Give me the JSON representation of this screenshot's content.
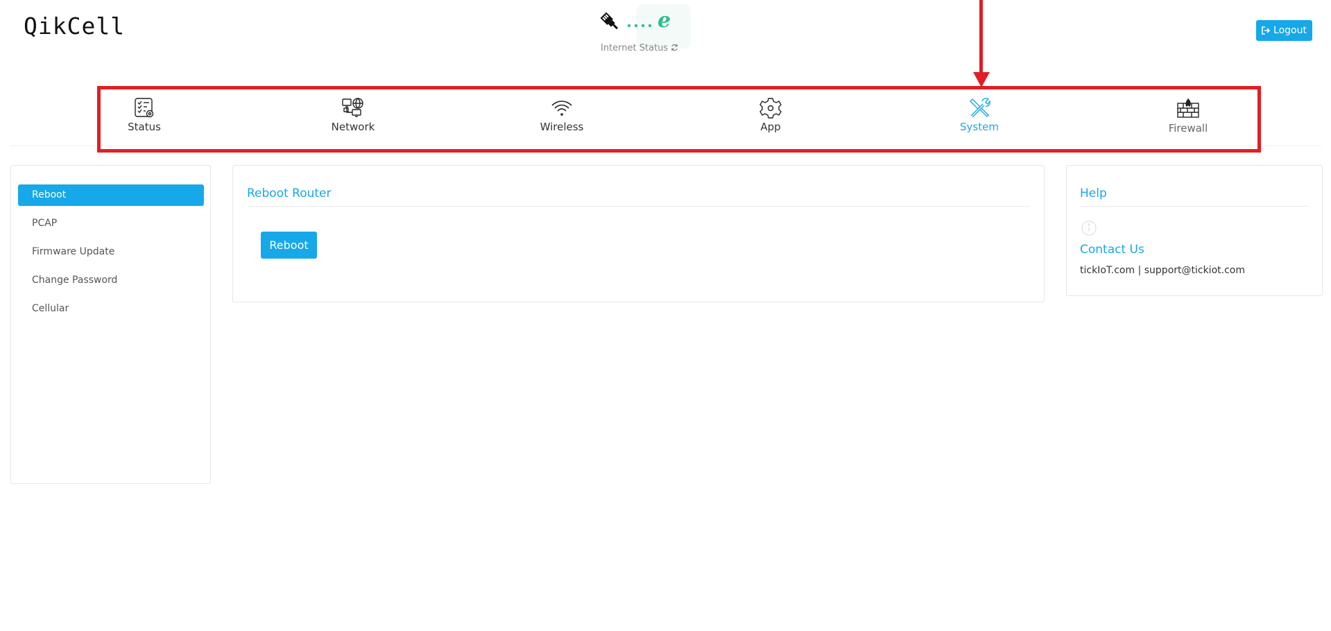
{
  "header": {
    "logo": "QikCell",
    "internet_status_label": "Internet Status",
    "logout_label": "Logout"
  },
  "nav": {
    "active": "System",
    "items": [
      {
        "label": "Status",
        "icon": "status-checklist-icon"
      },
      {
        "label": "Network",
        "icon": "network-computers-icon"
      },
      {
        "label": "Wireless",
        "icon": "wifi-icon"
      },
      {
        "label": "App",
        "icon": "gear-icon"
      },
      {
        "label": "System",
        "icon": "tools-icon"
      },
      {
        "label": "Firewall",
        "icon": "firewall-icon"
      }
    ]
  },
  "sidebar": {
    "items": [
      {
        "label": "Reboot",
        "active": true
      },
      {
        "label": "PCAP"
      },
      {
        "label": "Firmware Update"
      },
      {
        "label": "Change Password"
      },
      {
        "label": "Cellular"
      }
    ]
  },
  "main": {
    "title": "Reboot Router",
    "reboot_button": "Reboot"
  },
  "help": {
    "title": "Help",
    "contact_title": "Contact Us",
    "contact_site": "tickIoT.com",
    "separator": "|",
    "contact_email": "support@tickiot.com"
  },
  "colors": {
    "accent": "#16a8e8",
    "annotation": "#e01e24",
    "status_dots": "#2fbf8f"
  }
}
